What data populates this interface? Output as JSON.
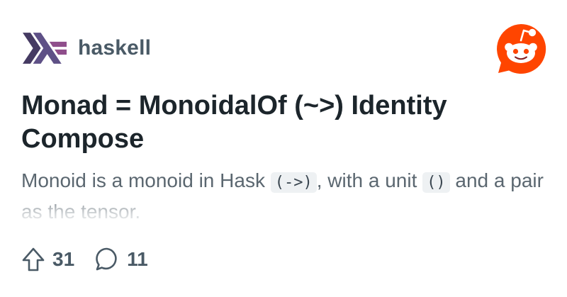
{
  "community": {
    "name": "haskell",
    "logo_icon": "haskell-logo-icon",
    "colors": {
      "dark": "#453a62",
      "mid": "#5e5086",
      "light": "#8f4e8b"
    }
  },
  "brand": {
    "logo_icon": "reddit-snoo-icon",
    "color": "#ff4500"
  },
  "post": {
    "title": "Monad = MonoidalOf (~>) Identity Compose",
    "body": {
      "part1": "Monoid is a monoid in Hask ",
      "code1": "(->)",
      "part2": ", with a unit ",
      "code2": "()",
      "part3": " and a pair as the tensor."
    }
  },
  "stats": {
    "upvotes": "31",
    "upvote_icon": "upvote-arrow-icon",
    "comments": "11",
    "comment_icon": "comment-bubble-icon"
  }
}
